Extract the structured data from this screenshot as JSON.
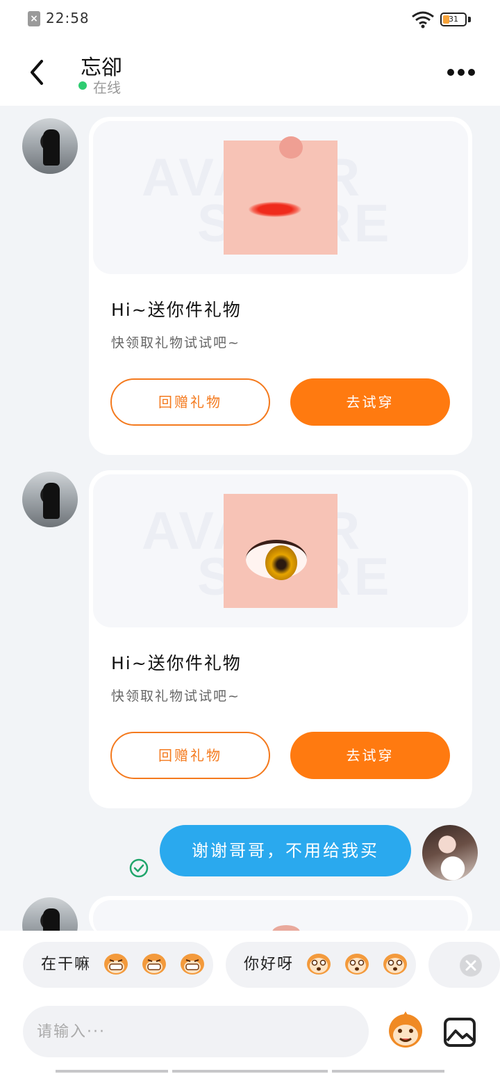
{
  "status_bar": {
    "time": "22:58",
    "battery_level": "31",
    "battery_fraction": 0.31,
    "notification_icon": "close-badge-icon"
  },
  "header": {
    "contact_name": "忘卻",
    "status_label": "在线",
    "status_color": "#2ecc71"
  },
  "messages": [
    {
      "type": "gift",
      "sender": "contact",
      "image": "lips",
      "watermark_line1": "AVATAR",
      "watermark_line2": "STORE",
      "title": "Hi~送你件礼物",
      "subtitle": "快领取礼物试试吧~",
      "reply_button": "回赠礼物",
      "try_button": "去试穿"
    },
    {
      "type": "gift",
      "sender": "contact",
      "image": "eye",
      "watermark_line1": "AVATAR",
      "watermark_line2": "STORE",
      "title": "Hi~送你件礼物",
      "subtitle": "快领取礼物试试吧~",
      "reply_button": "回赠礼物",
      "try_button": "去试穿"
    },
    {
      "type": "text",
      "sender": "me",
      "text": "谢谢哥哥，不用给我买",
      "read_icon": "check-circle-icon"
    }
  ],
  "quick_replies": [
    {
      "text": "在干嘛",
      "emoji": "grinning-monkey-emoji"
    },
    {
      "text": "你好呀",
      "emoji": "surprised-monkey-emoji"
    }
  ],
  "composer": {
    "placeholder": "请输入···",
    "emoji_button_icon": "monkey-face-icon",
    "image_button_icon": "image-icon"
  },
  "colors": {
    "accent_orange": "#ff7a10",
    "sent_bubble": "#2aa9ee",
    "background": "#f2f4f7"
  }
}
